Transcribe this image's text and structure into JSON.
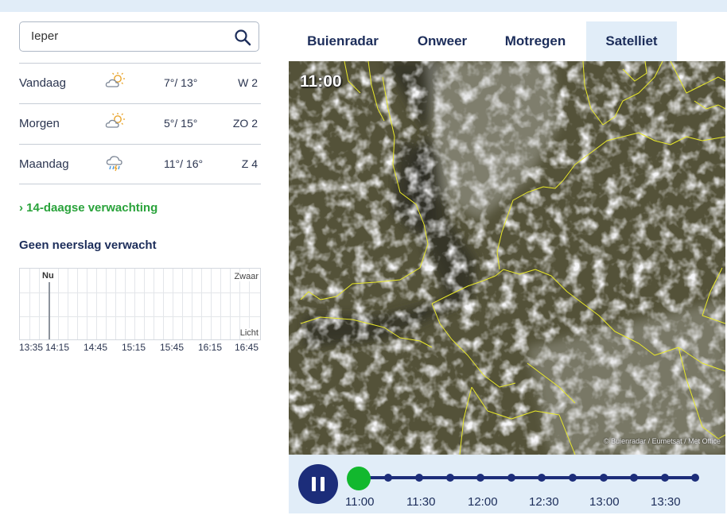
{
  "search": {
    "value": "Ieper"
  },
  "forecast": [
    {
      "day": "Vandaag",
      "icon": "sun-behind-cloud-icon",
      "temp": "7°/ 13°",
      "wind": "W 2"
    },
    {
      "day": "Morgen",
      "icon": "sun-behind-cloud-icon",
      "temp": "5°/ 15°",
      "wind": "ZO 2"
    },
    {
      "day": "Maandag",
      "icon": "rain-thunder-cloud-icon",
      "temp": "11°/ 16°",
      "wind": "Z 4"
    }
  ],
  "link_14day": "› 14-daagse verwachting",
  "rain": {
    "title": "Geen neerslag verwacht",
    "now_label": "Nu",
    "heavy_label": "Zwaar",
    "light_label": "Licht",
    "times": [
      "13:35",
      "14:15",
      "14:45",
      "15:15",
      "15:45",
      "16:15",
      "16:45"
    ]
  },
  "tabs": [
    "Buienradar",
    "Onweer",
    "Motregen",
    "Satelliet"
  ],
  "active_tab": "Satelliet",
  "map": {
    "time": "11:00",
    "credit": "© Buienradar / Eumetsat / Met Office"
  },
  "timeline": {
    "labels": [
      "11:00",
      "11:30",
      "12:00",
      "12:30",
      "13:00",
      "13:30"
    ],
    "position": 0
  },
  "colors": {
    "navy": "#1c2d7a",
    "accent_green": "#12b82e",
    "link_green": "#2aa33b",
    "light_blue": "#e1edf8"
  }
}
